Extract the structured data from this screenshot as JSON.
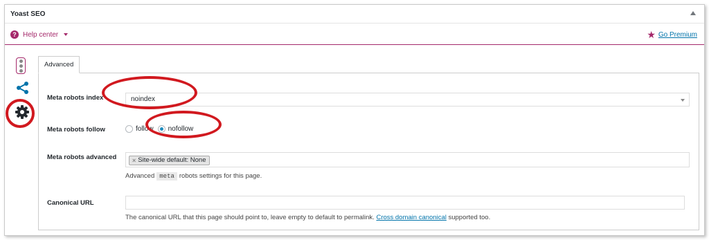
{
  "box": {
    "title": "Yoast SEO"
  },
  "helpbar": {
    "help_label": "Help center",
    "premium_label": "Go Premium"
  },
  "sidebar": {
    "items": [
      "traffic-light-icon",
      "share-icon",
      "gear-icon"
    ]
  },
  "tabs": [
    {
      "label": "Advanced",
      "active": true
    }
  ],
  "fields": {
    "robots_index": {
      "label": "Meta robots index",
      "value": "noindex"
    },
    "robots_follow": {
      "label": "Meta robots follow",
      "options": [
        "follow",
        "nofollow"
      ],
      "selected": "nofollow"
    },
    "robots_advanced": {
      "label": "Meta robots advanced",
      "chip_remove": "×",
      "chip": "Site-wide default: None",
      "desc_before": "Advanced",
      "desc_code": "meta",
      "desc_after": "robots settings for this page."
    },
    "canonical": {
      "label": "Canonical URL",
      "value": "",
      "desc_before": "The canonical URL that this page should point to, leave empty to default to permalink.",
      "desc_link": "Cross domain canonical",
      "desc_after": "supported too."
    }
  },
  "colors": {
    "brand": "#a4286a",
    "link": "#0073aa",
    "annotation": "#d1191f"
  }
}
